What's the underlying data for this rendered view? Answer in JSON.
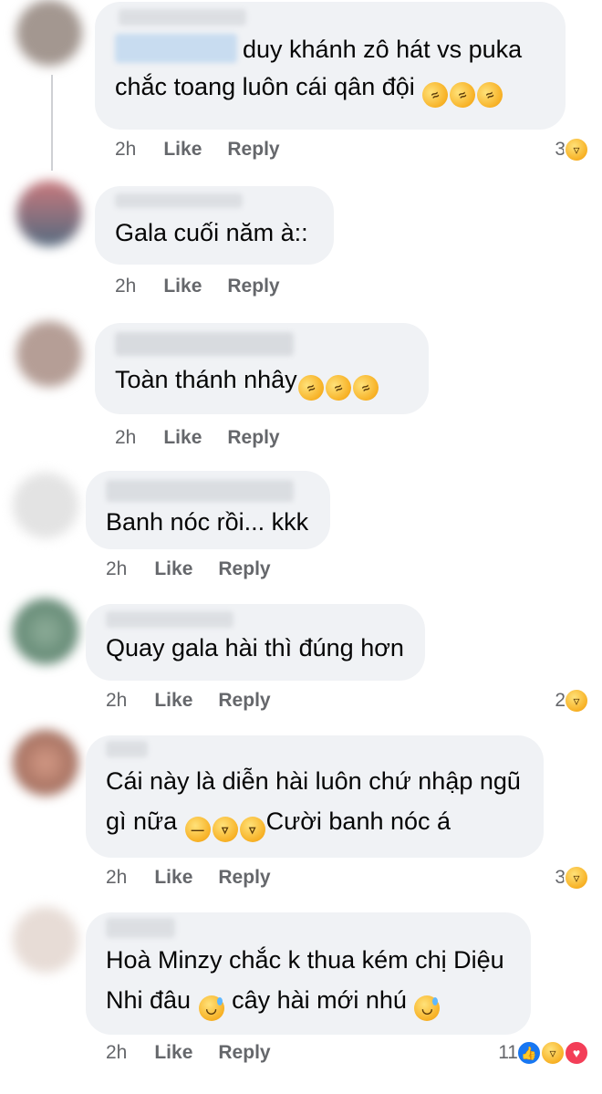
{
  "comments": [
    {
      "text_line1": "duy khánh zô hát vs puka",
      "text_line2": "chắc toang luôn cái qân đội",
      "emojis": [
        "rolling-laugh",
        "rolling-laugh",
        "rolling-laugh"
      ],
      "time": "2h",
      "like": "Like",
      "reply": "Reply",
      "reaction_count": "3",
      "reactions": [
        "haha"
      ]
    },
    {
      "text": "Gala cuối năm à::",
      "time": "2h",
      "like": "Like",
      "reply": "Reply"
    },
    {
      "text": "Toàn thánh nhây",
      "emojis": [
        "rolling-laugh",
        "rolling-laugh",
        "rolling-laugh"
      ],
      "time": "2h",
      "like": "Like",
      "reply": "Reply"
    },
    {
      "text": "Banh nóc rồi... kkk",
      "time": "2h",
      "like": "Like",
      "reply": "Reply"
    },
    {
      "text": "Quay gala hài thì đúng hơn",
      "time": "2h",
      "like": "Like",
      "reply": "Reply",
      "reaction_count": "2",
      "reactions": [
        "haha"
      ]
    },
    {
      "text_line1": "Cái này là diễn hài luôn chứ nhập ngũ",
      "text_line2_a": "gì nữa ",
      "text_line2_b": "Cười banh nóc á",
      "emojis": [
        "expressionless",
        "tears-of-joy",
        "tears-of-joy"
      ],
      "time": "2h",
      "like": "Like",
      "reply": "Reply",
      "reaction_count": "3",
      "reactions": [
        "haha"
      ]
    },
    {
      "text_line1": "Hoà Minzy chắc k thua kém chị Diệu",
      "text_line2_a": "Nhi đâu ",
      "text_line2_b": " cây hài mới nhú ",
      "emojis": [
        "sweat-smile",
        "sweat-smile"
      ],
      "time": "2h",
      "like": "Like",
      "reply": "Reply",
      "reaction_count": "11",
      "reactions": [
        "like",
        "haha",
        "love"
      ]
    }
  ]
}
